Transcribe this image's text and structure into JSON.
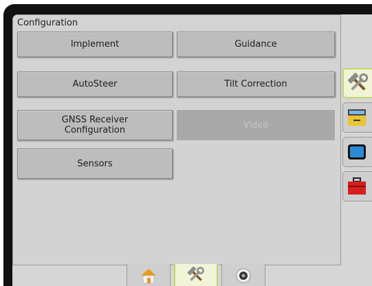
{
  "panel": {
    "title": "Configuration"
  },
  "buttons": {
    "implement": "Implement",
    "guidance": "Guidance",
    "autosteer": "AutoSteer",
    "tilt_correction": "Tilt Correction",
    "gnss_line1": "GNSS Receiver",
    "gnss_line2": "Configuration",
    "video": "Video",
    "sensors": "Sensors"
  },
  "side_tabs": [
    {
      "icon": "tools-icon",
      "active": true
    },
    {
      "icon": "console-icon",
      "active": false
    },
    {
      "icon": "display-icon",
      "active": false
    },
    {
      "icon": "toolbox-icon",
      "active": false
    }
  ],
  "bottom_tabs": [
    {
      "icon": "home-icon",
      "active": false
    },
    {
      "icon": "tools-icon",
      "active": true
    },
    {
      "icon": "camera-icon",
      "active": false
    }
  ],
  "colors": {
    "active_tab_bg": "#f1f4d6",
    "active_tab_border": "#c8d36a",
    "toolbox_red": "#d62020",
    "console_yellow": "#e8c531",
    "display_blue": "#2a8ad6",
    "home_orange": "#e99a1e"
  }
}
